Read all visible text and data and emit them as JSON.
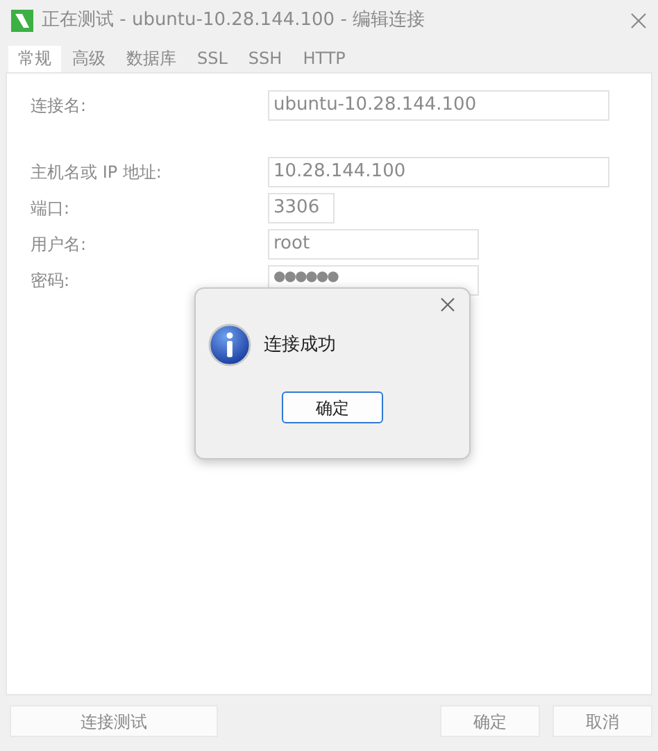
{
  "window": {
    "title": "正在测试 - ubuntu-10.28.144.100 - 编辑连接",
    "disabled": true
  },
  "tabs": [
    {
      "label": "常规",
      "selected": true
    },
    {
      "label": "高级",
      "selected": false
    },
    {
      "label": "数据库",
      "selected": false
    },
    {
      "label": "SSL",
      "selected": false
    },
    {
      "label": "SSH",
      "selected": false
    },
    {
      "label": "HTTP",
      "selected": false
    }
  ],
  "fields": [
    {
      "label": "连接名:",
      "value": "ubuntu-10.28.144.100"
    },
    {
      "label": "主机名或 IP 地址:",
      "value": "10.28.144.100"
    },
    {
      "label": "端口:",
      "value": "3306"
    },
    {
      "label": "用户名:",
      "value": "root"
    },
    {
      "label": "密码:",
      "value": "●●●●●●"
    }
  ],
  "dialog": {
    "message": "连接成功",
    "button": "确定"
  },
  "buttons": [
    "连接测试",
    "确定",
    "取消"
  ]
}
